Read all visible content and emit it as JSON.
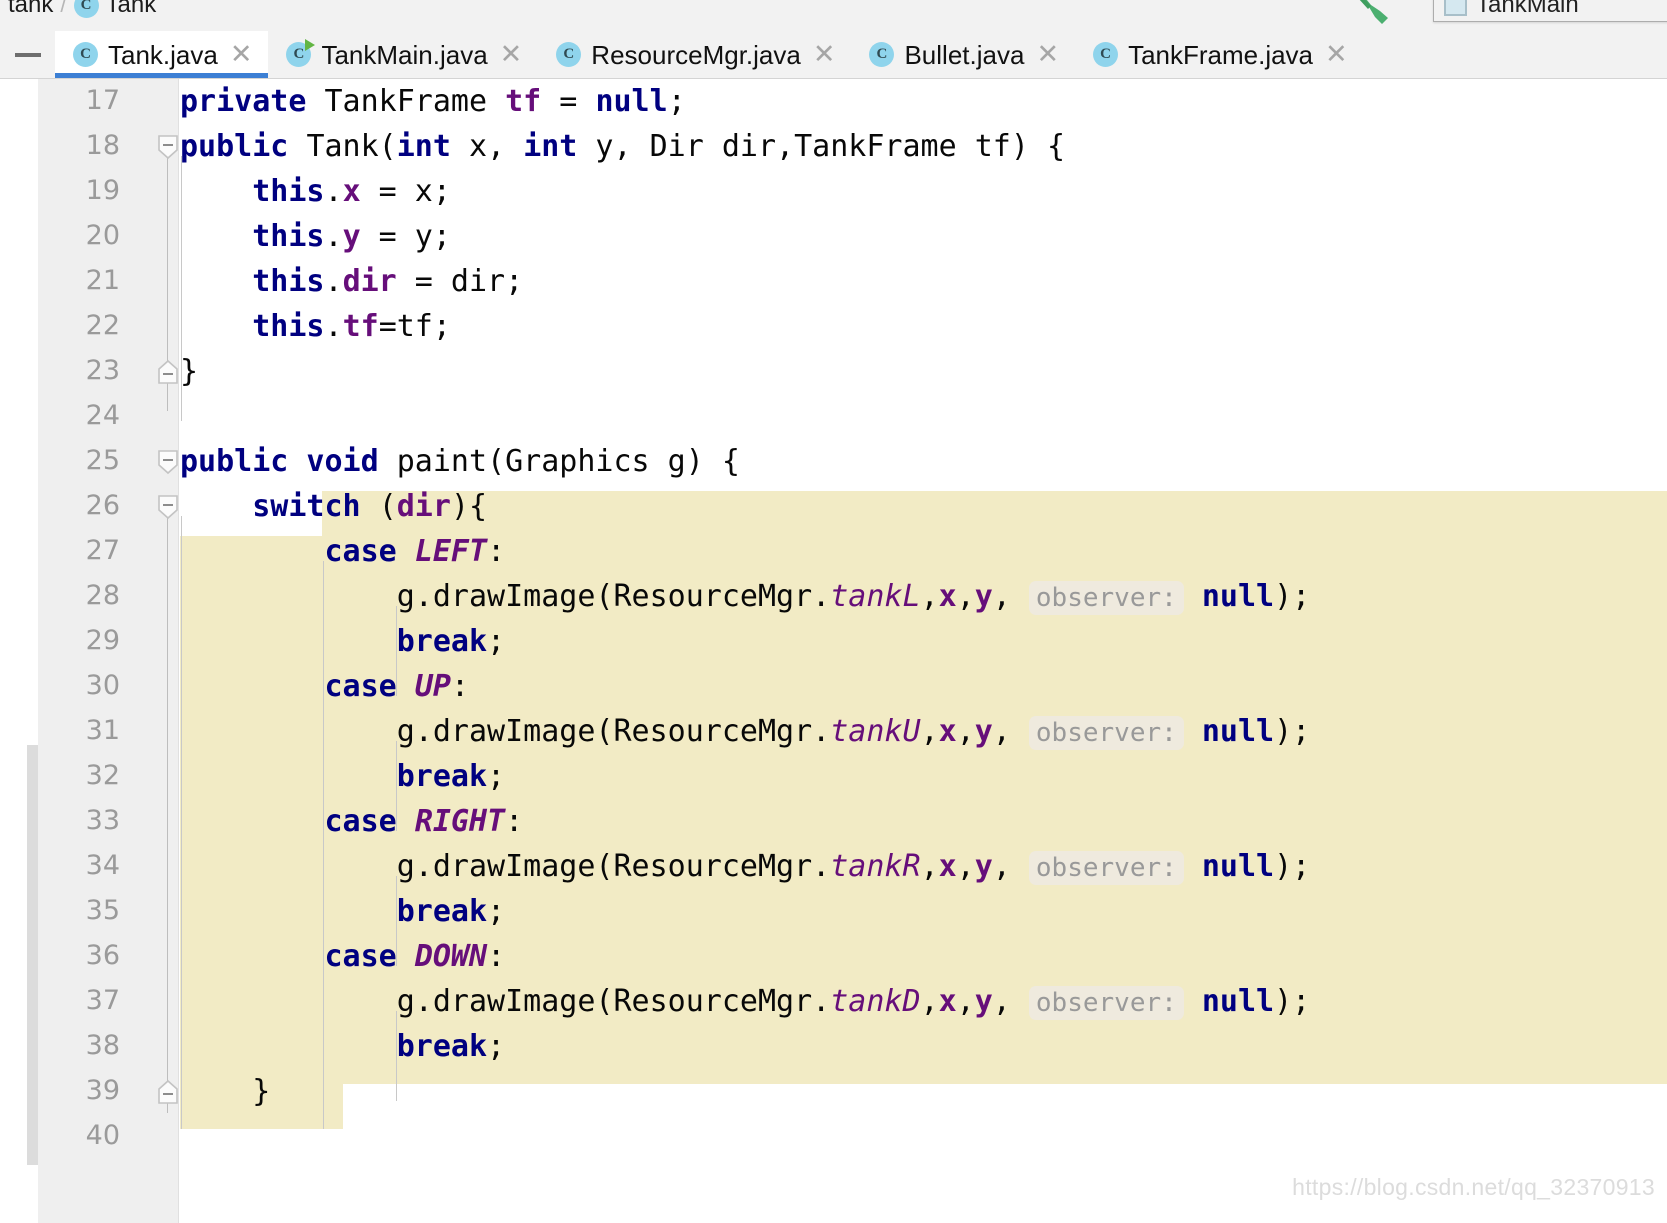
{
  "breadcrumb": {
    "package": "tank",
    "separator": "/",
    "class_icon": "class-icon",
    "class": "Tank"
  },
  "run_widget": {
    "icon": "window-icon",
    "label": "TankMain",
    "wrench_icon": "wrench-icon"
  },
  "tabbar": {
    "collapse_icon": "minimize-icon",
    "close_glyph": "✕",
    "tabs": [
      {
        "icon": "java-class-icon",
        "label": "Tank.java",
        "active": true,
        "runnable": false
      },
      {
        "icon": "java-class-runnable-icon",
        "label": "TankMain.java",
        "active": false,
        "runnable": true
      },
      {
        "icon": "java-class-icon",
        "label": "ResourceMgr.java",
        "active": false,
        "runnable": false
      },
      {
        "icon": "java-class-icon",
        "label": "Bullet.java",
        "active": false,
        "runnable": false
      },
      {
        "icon": "java-class-icon",
        "label": "TankFrame.java",
        "active": false,
        "runnable": false
      }
    ]
  },
  "editor": {
    "first_line": 17,
    "line_numbers": [
      17,
      18,
      19,
      20,
      21,
      22,
      23,
      24,
      25,
      26,
      27,
      28,
      29,
      30,
      31,
      32,
      33,
      34,
      35,
      36,
      37,
      38,
      39,
      40
    ],
    "folds": [
      {
        "line": 18,
        "type": "collapse-marker"
      },
      {
        "line": 23,
        "type": "collapse-end-marker"
      },
      {
        "line": 25,
        "type": "collapse-marker"
      },
      {
        "line": 26,
        "type": "collapse-marker"
      },
      {
        "line": 39,
        "type": "collapse-end-marker"
      }
    ],
    "hint_label": "observer:",
    "colors": {
      "keyword": "#000080",
      "field": "#660e7a",
      "enum_constant": "#660e7a",
      "static_field": "#660e7a",
      "highlight_background": "#f2ebc5",
      "hint_background": "#efeade",
      "hint_text": "#999999",
      "tab_underline": "#3c7fd4",
      "gutter_background": "#efefef",
      "line_number": "#9a9a9a"
    },
    "lines": [
      {
        "n": 17,
        "segments": [
          {
            "t": "private ",
            "c": "kw"
          },
          {
            "t": "TankFrame ",
            "c": "pln"
          },
          {
            "t": "tf",
            "c": "fld"
          },
          {
            "t": " = ",
            "c": "pln"
          },
          {
            "t": "null",
            "c": "nul"
          },
          {
            "t": ";",
            "c": "pln"
          }
        ]
      },
      {
        "n": 18,
        "segments": [
          {
            "t": "public ",
            "c": "kw"
          },
          {
            "t": "Tank(",
            "c": "pln"
          },
          {
            "t": "int",
            "c": "kw"
          },
          {
            "t": " x, ",
            "c": "pln"
          },
          {
            "t": "int",
            "c": "kw"
          },
          {
            "t": " y, Dir dir,TankFrame tf) {",
            "c": "pln"
          }
        ]
      },
      {
        "n": 19,
        "segments": [
          {
            "t": "    this",
            "c": "kw"
          },
          {
            "t": ".",
            "c": "pln"
          },
          {
            "t": "x",
            "c": "fld"
          },
          {
            "t": " = x;",
            "c": "pln"
          }
        ]
      },
      {
        "n": 20,
        "segments": [
          {
            "t": "    this",
            "c": "kw"
          },
          {
            "t": ".",
            "c": "pln"
          },
          {
            "t": "y",
            "c": "fld"
          },
          {
            "t": " = y;",
            "c": "pln"
          }
        ]
      },
      {
        "n": 21,
        "segments": [
          {
            "t": "    this",
            "c": "kw"
          },
          {
            "t": ".",
            "c": "pln"
          },
          {
            "t": "dir",
            "c": "fld"
          },
          {
            "t": " = dir;",
            "c": "pln"
          }
        ]
      },
      {
        "n": 22,
        "segments": [
          {
            "t": "    this",
            "c": "kw"
          },
          {
            "t": ".",
            "c": "pln"
          },
          {
            "t": "tf",
            "c": "fld"
          },
          {
            "t": "=tf;",
            "c": "pln"
          }
        ]
      },
      {
        "n": 23,
        "segments": [
          {
            "t": "}",
            "c": "pln"
          }
        ]
      },
      {
        "n": 24,
        "segments": []
      },
      {
        "n": 25,
        "segments": [
          {
            "t": "public void ",
            "c": "kw"
          },
          {
            "t": "paint(Graphics g) {",
            "c": "pln"
          }
        ]
      },
      {
        "n": 26,
        "segments": [
          {
            "t": "    switch ",
            "c": "kw"
          },
          {
            "t": "(",
            "c": "pln"
          },
          {
            "t": "dir",
            "c": "fld"
          },
          {
            "t": "){",
            "c": "pln"
          }
        ]
      },
      {
        "n": 27,
        "segments": [
          {
            "t": "        case ",
            "c": "kw"
          },
          {
            "t": "LEFT",
            "c": "enu"
          },
          {
            "t": ":",
            "c": "pln"
          }
        ]
      },
      {
        "n": 28,
        "segments": [
          {
            "t": "            g.drawImage(ResourceMgr.",
            "c": "pln"
          },
          {
            "t": "tankL",
            "c": "sfld"
          },
          {
            "t": ",",
            "c": "pln"
          },
          {
            "t": "x",
            "c": "fld"
          },
          {
            "t": ",",
            "c": "pln"
          },
          {
            "t": "y",
            "c": "fld"
          },
          {
            "t": ", ",
            "c": "pln"
          },
          {
            "t": "observer:",
            "c": "hint"
          },
          {
            "t": " ",
            "c": "pln"
          },
          {
            "t": "null",
            "c": "nul"
          },
          {
            "t": ");",
            "c": "pln"
          }
        ]
      },
      {
        "n": 29,
        "segments": [
          {
            "t": "            break",
            "c": "kw"
          },
          {
            "t": ";",
            "c": "pln"
          }
        ]
      },
      {
        "n": 30,
        "segments": [
          {
            "t": "        case ",
            "c": "kw"
          },
          {
            "t": "UP",
            "c": "enu"
          },
          {
            "t": ":",
            "c": "pln"
          }
        ]
      },
      {
        "n": 31,
        "segments": [
          {
            "t": "            g.drawImage(ResourceMgr.",
            "c": "pln"
          },
          {
            "t": "tankU",
            "c": "sfld"
          },
          {
            "t": ",",
            "c": "pln"
          },
          {
            "t": "x",
            "c": "fld"
          },
          {
            "t": ",",
            "c": "pln"
          },
          {
            "t": "y",
            "c": "fld"
          },
          {
            "t": ", ",
            "c": "pln"
          },
          {
            "t": "observer:",
            "c": "hint"
          },
          {
            "t": " ",
            "c": "pln"
          },
          {
            "t": "null",
            "c": "nul"
          },
          {
            "t": ");",
            "c": "pln"
          }
        ]
      },
      {
        "n": 32,
        "segments": [
          {
            "t": "            break",
            "c": "kw"
          },
          {
            "t": ";",
            "c": "pln"
          }
        ]
      },
      {
        "n": 33,
        "segments": [
          {
            "t": "        case ",
            "c": "kw"
          },
          {
            "t": "RIGHT",
            "c": "enu"
          },
          {
            "t": ":",
            "c": "pln"
          }
        ]
      },
      {
        "n": 34,
        "segments": [
          {
            "t": "            g.drawImage(ResourceMgr.",
            "c": "pln"
          },
          {
            "t": "tankR",
            "c": "sfld"
          },
          {
            "t": ",",
            "c": "pln"
          },
          {
            "t": "x",
            "c": "fld"
          },
          {
            "t": ",",
            "c": "pln"
          },
          {
            "t": "y",
            "c": "fld"
          },
          {
            "t": ", ",
            "c": "pln"
          },
          {
            "t": "observer:",
            "c": "hint"
          },
          {
            "t": " ",
            "c": "pln"
          },
          {
            "t": "null",
            "c": "nul"
          },
          {
            "t": ");",
            "c": "pln"
          }
        ]
      },
      {
        "n": 35,
        "segments": [
          {
            "t": "            break",
            "c": "kw"
          },
          {
            "t": ";",
            "c": "pln"
          }
        ]
      },
      {
        "n": 36,
        "segments": [
          {
            "t": "        case ",
            "c": "kw"
          },
          {
            "t": "DOWN",
            "c": "enu"
          },
          {
            "t": ":",
            "c": "pln"
          }
        ]
      },
      {
        "n": 37,
        "segments": [
          {
            "t": "            g.drawImage(ResourceMgr.",
            "c": "pln"
          },
          {
            "t": "tankD",
            "c": "sfld"
          },
          {
            "t": ",",
            "c": "pln"
          },
          {
            "t": "x",
            "c": "fld"
          },
          {
            "t": ",",
            "c": "pln"
          },
          {
            "t": "y",
            "c": "fld"
          },
          {
            "t": ", ",
            "c": "pln"
          },
          {
            "t": "observer:",
            "c": "hint"
          },
          {
            "t": " ",
            "c": "pln"
          },
          {
            "t": "null",
            "c": "nul"
          },
          {
            "t": ");",
            "c": "pln"
          }
        ]
      },
      {
        "n": 38,
        "segments": [
          {
            "t": "            break",
            "c": "kw"
          },
          {
            "t": ";",
            "c": "pln"
          }
        ]
      },
      {
        "n": 39,
        "segments": [
          {
            "t": "    }",
            "c": "pln"
          }
        ]
      },
      {
        "n": 40,
        "segments": []
      }
    ]
  },
  "watermark": "https://blog.csdn.net/qq_32370913"
}
